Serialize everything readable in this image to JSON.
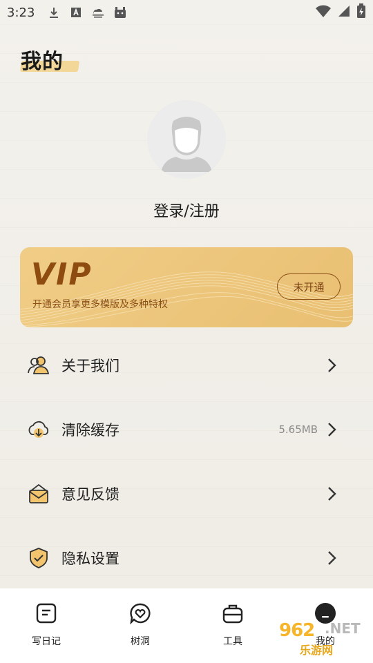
{
  "status_bar": {
    "time": "3:23",
    "icons": [
      "download-icon",
      "font-icon",
      "cloud-icon",
      "android-icon"
    ],
    "right_icons": [
      "wifi-icon",
      "signal-icon",
      "battery-icon"
    ]
  },
  "header": {
    "title": "我的"
  },
  "profile": {
    "avatar_icon": "default-avatar-icon",
    "login_label": "登录/注册"
  },
  "vip": {
    "title": "VIP",
    "subtitle": "开通会员享更多模版及多种特权",
    "button_label": "未开通",
    "colors": {
      "card": "#ebc57a",
      "text": "#8e4c10"
    }
  },
  "menu": [
    {
      "label": "关于我们",
      "icon": "users-icon",
      "value": ""
    },
    {
      "label": "清除缓存",
      "icon": "cloud-download-icon",
      "value": "5.65MB"
    },
    {
      "label": "意见反馈",
      "icon": "mail-icon",
      "value": ""
    },
    {
      "label": "隐私设置",
      "icon": "shield-check-icon",
      "value": ""
    }
  ],
  "bottom_nav": [
    {
      "label": "写日记",
      "icon": "note-icon"
    },
    {
      "label": "树洞",
      "icon": "heart-bubble-icon"
    },
    {
      "label": "工具",
      "icon": "toolbox-icon"
    },
    {
      "label": "我的",
      "icon": "profile-dot-icon"
    }
  ],
  "watermark": {
    "num": "962",
    "net": ".NET",
    "cn": "乐游网"
  }
}
